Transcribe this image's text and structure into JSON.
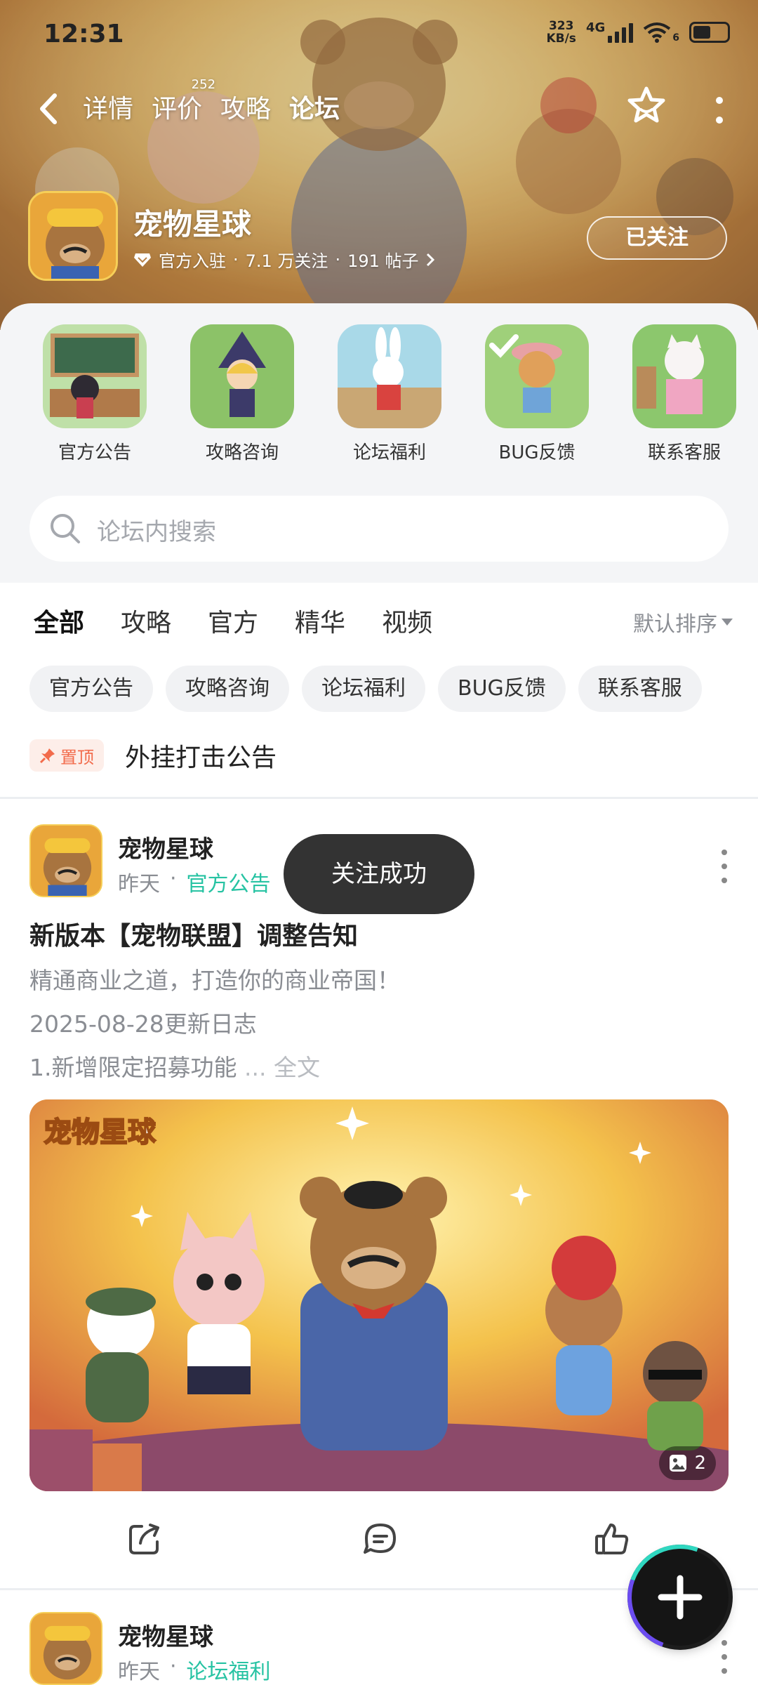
{
  "status_bar": {
    "time": "12:31",
    "net_speed_value": "323",
    "net_speed_unit": "KB/s",
    "network": "4G",
    "sim_index": "6"
  },
  "nav": {
    "tabs": [
      {
        "label": "详情"
      },
      {
        "label": "评价",
        "count": "252"
      },
      {
        "label": "攻略"
      },
      {
        "label": "论坛",
        "active": true
      }
    ]
  },
  "game": {
    "name": "宠物星球",
    "badge": "官方入驻",
    "followers": "7.1 万关注",
    "posts": "191 帖子",
    "follow_label": "已关注"
  },
  "categories": [
    {
      "label": "官方公告"
    },
    {
      "label": "攻略咨询"
    },
    {
      "label": "论坛福利"
    },
    {
      "label": "BUG反馈"
    },
    {
      "label": "联系客服"
    }
  ],
  "search": {
    "placeholder": "论坛内搜索"
  },
  "filter_tabs": [
    "全部",
    "攻略",
    "官方",
    "精华",
    "视频"
  ],
  "sort_label": "默认排序",
  "chips": [
    "官方公告",
    "攻略咨询",
    "论坛福利",
    "BUG反馈",
    "联系客服"
  ],
  "pinned": {
    "badge": "置顶",
    "title": "外挂打击公告"
  },
  "post": {
    "author": "宠物星球",
    "time": "昨天",
    "category": "官方公告",
    "title": "新版本【宠物联盟】调整告知",
    "lines": [
      "精通商业之道，打造你的商业帝国！",
      "2025-08-28更新日志",
      "1.新增限定招募功能"
    ],
    "ellipsis": " ... ",
    "more": "全文",
    "image_logo": "宠物星球",
    "image_count": "2"
  },
  "post2": {
    "author": "宠物星球",
    "time": "昨天",
    "category": "论坛福利"
  },
  "toast": "关注成功",
  "colors": {
    "accent": "#33d1b0",
    "pin": "#f26b4b",
    "category": "#27c3a3"
  }
}
